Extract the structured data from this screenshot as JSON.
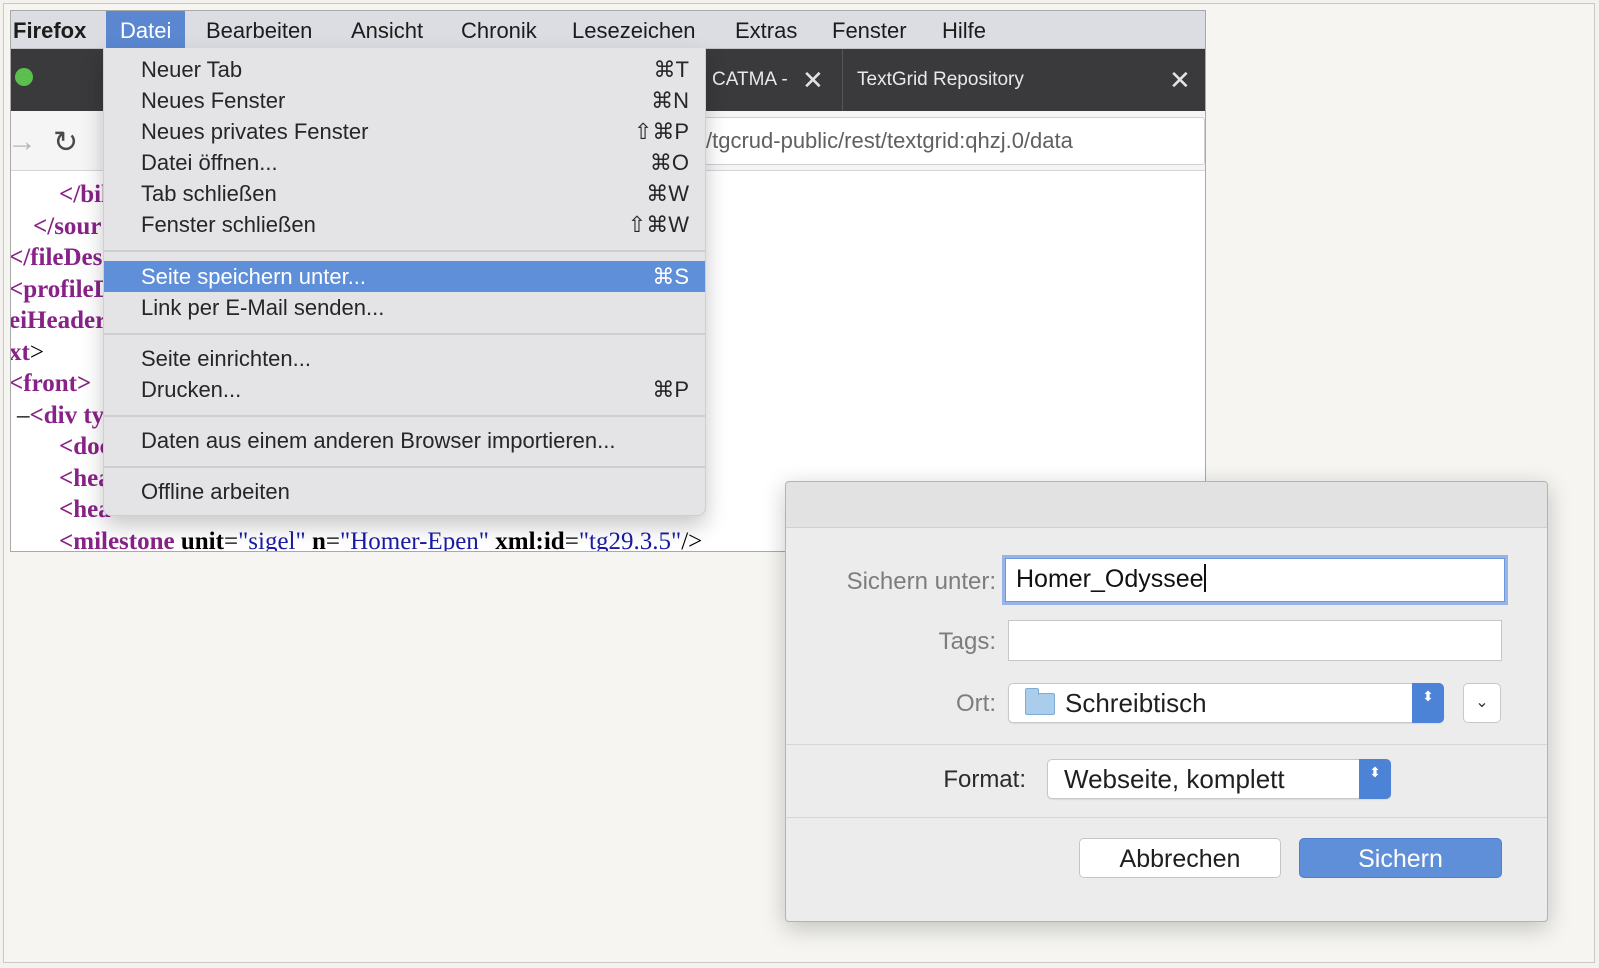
{
  "menubar": {
    "app_name": "Firefox",
    "items": [
      "Datei",
      "Bearbeiten",
      "Ansicht",
      "Chronik",
      "Lesezeichen",
      "Extras",
      "Fenster",
      "Hilfe"
    ]
  },
  "tabs": [
    {
      "title": "CATMA -"
    },
    {
      "title": "TextGrid Repository"
    }
  ],
  "icons": {
    "close": "✕",
    "forward": "→",
    "reload": "↻",
    "dropdown": "⌄",
    "stepper": "⬍"
  },
  "urlbar": {
    "value": "/tgcrud-public/rest/textgrid:qhzj.0/data"
  },
  "xml": {
    "l1": "</bil",
    "l2": "</sour",
    "l3": "</fileDesc",
    "l4": "<profileD",
    "l5": "eiHeader",
    "l6_tag": "xt",
    "l6_close": ">",
    "l7": "<front>",
    "l8_dash": "–",
    "l8_tag": "<div ty",
    "l9": "<doc",
    "l10": "<hea",
    "l11": "<hea",
    "l12": {
      "open": "<milestone",
      "a1": " unit",
      "eq1": "=",
      "v1": "\"sigel\"",
      "a2": " n",
      "eq2": "=",
      "v2": "\"Homer-Epen\"",
      "a3": " xml:id",
      "eq3": "=",
      "v3": "\"tg29.3.5\"",
      "close": "/>"
    }
  },
  "datei_menu": {
    "items": [
      {
        "label": "Neuer Tab",
        "shortcut": "⌘T"
      },
      {
        "label": "Neues Fenster",
        "shortcut": "⌘N"
      },
      {
        "label": "Neues privates Fenster",
        "shortcut": "⇧⌘P"
      },
      {
        "label": "Datei öffnen...",
        "shortcut": "⌘O"
      },
      {
        "label": "Tab schließen",
        "shortcut": "⌘W"
      },
      {
        "label": "Fenster schließen",
        "shortcut": "⇧⌘W"
      },
      {
        "label": "Seite speichern unter...",
        "shortcut": "⌘S"
      },
      {
        "label": "Link per E-Mail senden...",
        "shortcut": ""
      },
      {
        "label": "Seite einrichten...",
        "shortcut": ""
      },
      {
        "label": "Drucken...",
        "shortcut": "⌘P"
      },
      {
        "label": "Daten aus einem anderen Browser importieren...",
        "shortcut": ""
      },
      {
        "label": "Offline arbeiten",
        "shortcut": ""
      }
    ]
  },
  "save_dialog": {
    "save_as_label": "Sichern unter:",
    "save_as_value": "Homer_Odyssee",
    "tags_label": "Tags:",
    "tags_value": "",
    "location_label": "Ort:",
    "location_value": "Schreibtisch",
    "format_label": "Format:",
    "format_value": "Webseite, komplett",
    "cancel_label": "Abbrechen",
    "save_label": "Sichern"
  },
  "colors": {
    "menu_active": "#5b87d1",
    "highlight": "#5f8fd8",
    "xml_tag": "#882288",
    "xml_value": "#1a1aa6"
  }
}
